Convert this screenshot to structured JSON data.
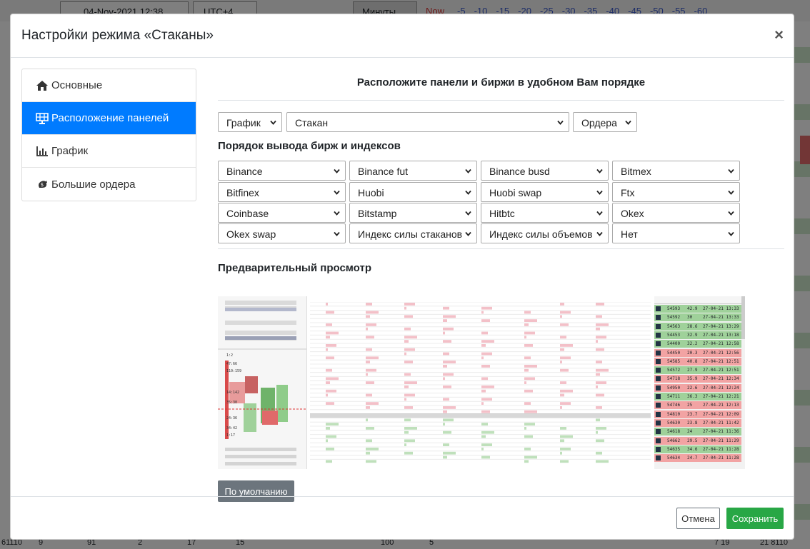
{
  "background": {
    "date_value": "04-Nov-2021 12:38",
    "timezone": "UTC+4",
    "unit": "Минуты",
    "now_label": "Now",
    "offsets": [
      "-5",
      "-10",
      "-15",
      "-20",
      "-25",
      "-30",
      "-35",
      "-40",
      "-45",
      "-50",
      "-55",
      "-60"
    ],
    "bottom_ticks": [
      "61110",
      "9",
      "91",
      "2",
      "17",
      "15",
      "100",
      "5",
      "7 19",
      "21 8110"
    ]
  },
  "modal": {
    "title": "Настройки режима «Стаканы»",
    "close_symbol": "×"
  },
  "nav": {
    "items": [
      {
        "label": "Основные",
        "icon": "home-icon",
        "active": false
      },
      {
        "label": "Расположение панелей",
        "icon": "solar-panel-icon",
        "active": true
      },
      {
        "label": "График",
        "icon": "bar-chart-icon",
        "active": false
      },
      {
        "label": "Большие ордера",
        "icon": "money-icon",
        "active": false
      }
    ]
  },
  "panels": {
    "heading": "Расположите панели и биржи в удобном Вам порядке",
    "panel_selects": [
      "График",
      "Стакан",
      "Ордера"
    ]
  },
  "exchanges": {
    "heading": "Порядок вывода бирж и индексов",
    "selects": [
      "Binance",
      "Binance fut",
      "Binance busd",
      "Bitmex",
      "Bitfinex",
      "Huobi",
      "Huobi swap",
      "Ftx",
      "Coinbase",
      "Bitstamp",
      "Hitbtc",
      "Okex",
      "Okex swap",
      "Индекс силы стаканов",
      "Индекс силы объемов",
      "Нет"
    ]
  },
  "preview": {
    "heading": "Предварительный просмотр",
    "default_button": "По умолчанию",
    "orders": [
      {
        "price": "54593",
        "size": "42.9",
        "time": "27-04-21 13:33",
        "side": "buy"
      },
      {
        "price": "54592",
        "size": "30",
        "time": "27-04-21 13:33",
        "side": "buy"
      },
      {
        "price": "54563",
        "size": "28.6",
        "time": "27-04-21 13:29",
        "side": "buy"
      },
      {
        "price": "54453",
        "size": "32.9",
        "time": "27-04-21 13:18",
        "side": "buy"
      },
      {
        "price": "54400",
        "size": "32.2",
        "time": "27-04-21 12:58",
        "side": "buy"
      },
      {
        "price": "54450",
        "size": "20.3",
        "time": "27-04-21 12:56",
        "side": "sell"
      },
      {
        "price": "54585",
        "size": "40.8",
        "time": "27-04-21 12:51",
        "side": "sell"
      },
      {
        "price": "54572",
        "size": "27.9",
        "time": "27-04-21 12:51",
        "side": "buy"
      },
      {
        "price": "54718",
        "size": "35.9",
        "time": "27-04-21 12:34",
        "side": "sell"
      },
      {
        "price": "54950",
        "size": "22.6",
        "time": "27-04-21 12:24",
        "side": "sell"
      },
      {
        "price": "54711",
        "size": "36.3",
        "time": "27-04-21 12:21",
        "side": "buy"
      },
      {
        "price": "54746",
        "size": "25",
        "time": "27-04-21 12:13",
        "side": "sell"
      },
      {
        "price": "54810",
        "size": "23.7",
        "time": "27-04-21 12:09",
        "side": "sell"
      },
      {
        "price": "54630",
        "size": "23.8",
        "time": "27-04-21 11:42",
        "side": "sell"
      },
      {
        "price": "54618",
        "size": "24",
        "time": "27-04-21 11:36",
        "side": "buy"
      },
      {
        "price": "54662",
        "size": "29.5",
        "time": "27-04-21 11:29",
        "side": "sell"
      },
      {
        "price": "54635",
        "size": "34.6",
        "time": "27-04-21 11:28",
        "side": "buy"
      },
      {
        "price": "54634",
        "size": "24.7",
        "time": "27-04-21 11:28",
        "side": "sell"
      }
    ]
  },
  "footer": {
    "cancel": "Отмена",
    "save": "Сохранить"
  },
  "colors": {
    "primary": "#007bff",
    "success": "#28a745",
    "secondary": "#6c757d",
    "buy": "#9fd19a",
    "sell": "#f2a3a3"
  }
}
